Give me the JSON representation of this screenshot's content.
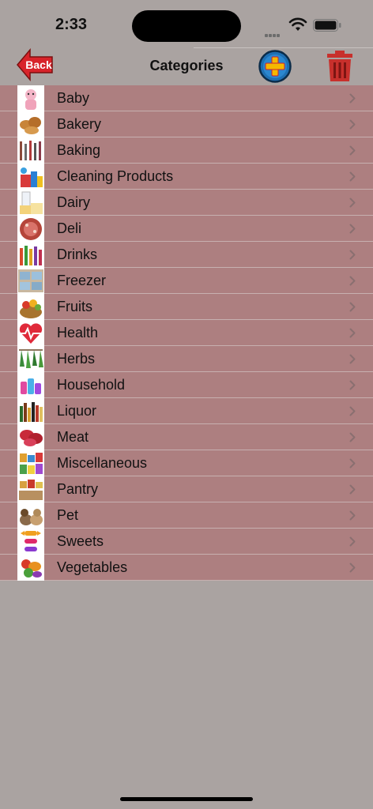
{
  "status": {
    "time": "2:33"
  },
  "nav": {
    "title": "Categories",
    "back_label": "Back"
  },
  "categories": [
    {
      "label": "Baby",
      "icon": "baby-icon"
    },
    {
      "label": "Bakery",
      "icon": "bread-icon"
    },
    {
      "label": "Baking",
      "icon": "utensils-icon"
    },
    {
      "label": "Cleaning Products",
      "icon": "cleaning-icon"
    },
    {
      "label": "Dairy",
      "icon": "milk-cheese-icon"
    },
    {
      "label": "Deli",
      "icon": "deli-meat-icon"
    },
    {
      "label": "Drinks",
      "icon": "drink-bottles-icon"
    },
    {
      "label": "Freezer",
      "icon": "freezer-icon"
    },
    {
      "label": "Fruits",
      "icon": "fruit-basket-icon"
    },
    {
      "label": "Health",
      "icon": "heart-pulse-icon"
    },
    {
      "label": "Herbs",
      "icon": "herbs-icon"
    },
    {
      "label": "Household",
      "icon": "household-icon"
    },
    {
      "label": "Liquor",
      "icon": "liquor-bottles-icon"
    },
    {
      "label": "Meat",
      "icon": "meat-icon"
    },
    {
      "label": "Miscellaneous",
      "icon": "groceries-icon"
    },
    {
      "label": "Pantry",
      "icon": "pantry-icon"
    },
    {
      "label": "Pet",
      "icon": "pets-icon"
    },
    {
      "label": "Sweets",
      "icon": "candy-icon"
    },
    {
      "label": "Vegetables",
      "icon": "vegetables-icon"
    }
  ],
  "colors": {
    "background": "#aaa3a1",
    "row": "#ad7f80",
    "back_button": "#d8232a",
    "add_button": "#1e6fb3",
    "add_cross": "#f5b800",
    "trash": "#c8302c"
  }
}
